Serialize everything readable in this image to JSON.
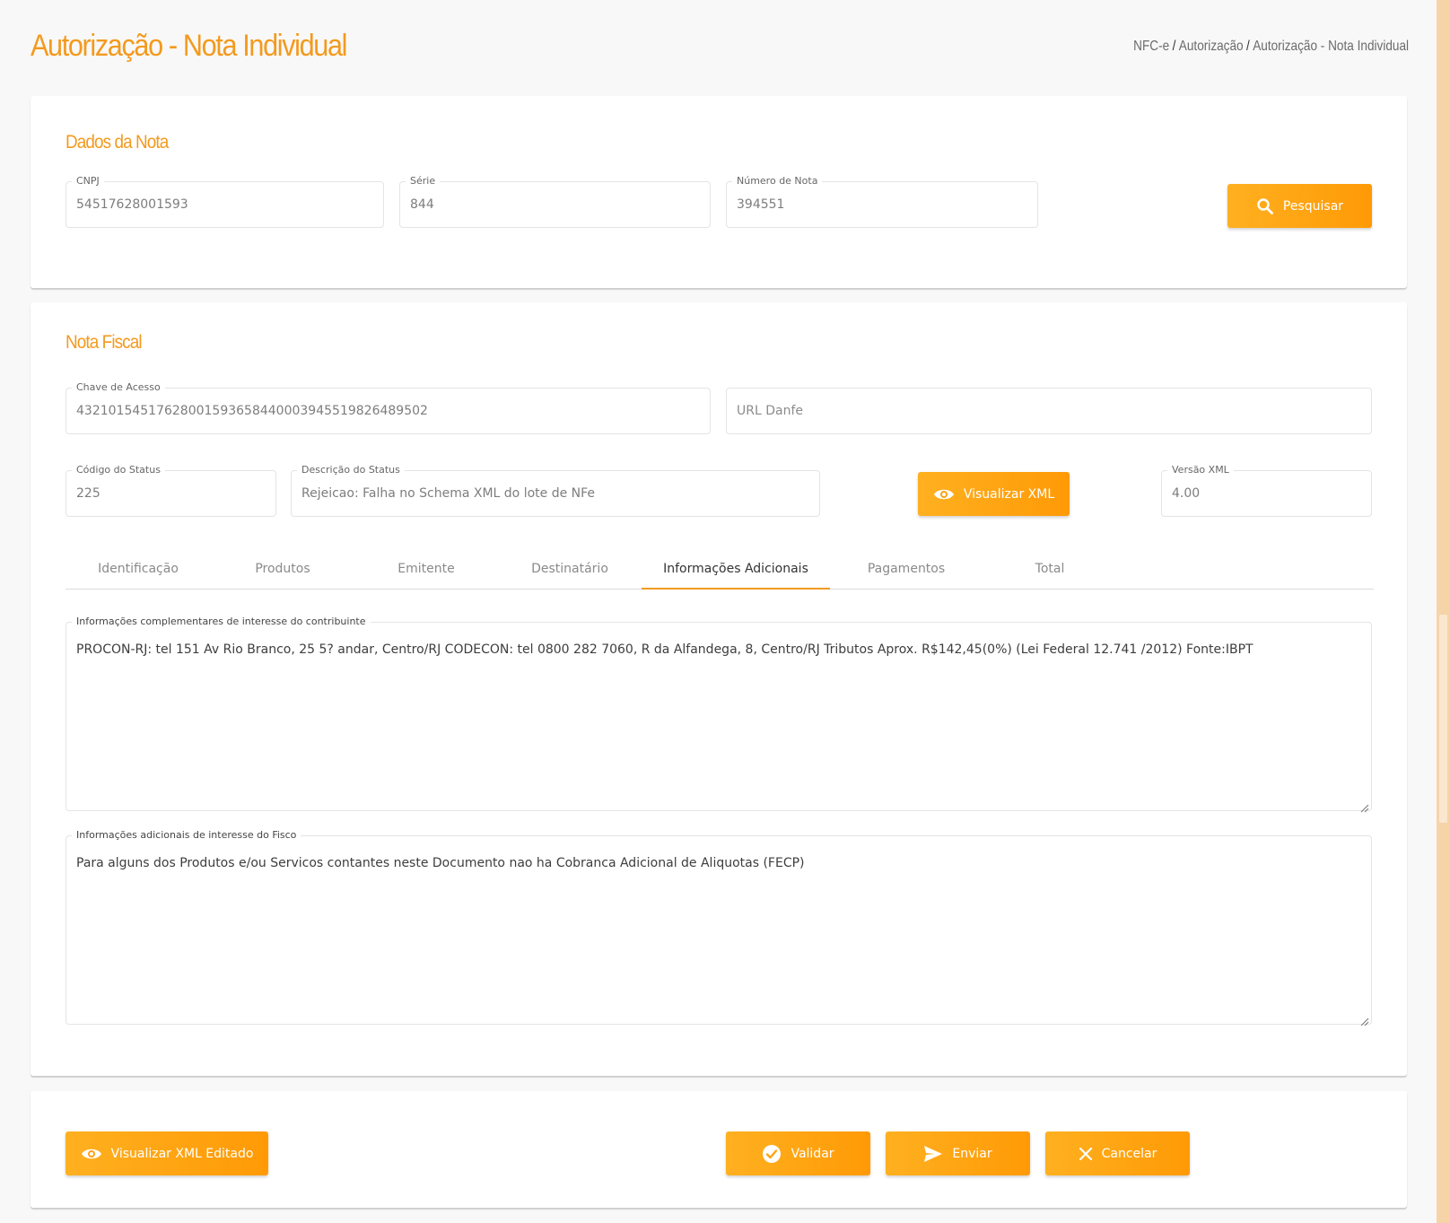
{
  "page": {
    "title": "Autorização - Nota Individual",
    "breadcrumb": [
      "NFC-e",
      "Autorização",
      "Autorização - Nota Individual"
    ]
  },
  "dados_nota": {
    "title": "Dados da Nota",
    "cnpj": {
      "label": "CNPJ",
      "value": "54517628001593"
    },
    "serie": {
      "label": "Série",
      "value": "844"
    },
    "numero": {
      "label": "Número de Nota",
      "value": "394551"
    },
    "search_button": "Pesquisar"
  },
  "nota_fiscal": {
    "title": "Nota Fiscal",
    "chave": {
      "label": "Chave de Acesso",
      "value": "43210154517628001593658440003945519826489502"
    },
    "url_danfe": {
      "placeholder": "URL Danfe"
    },
    "codigo_status": {
      "label": "Código do Status",
      "value": "225"
    },
    "descricao_status": {
      "label": "Descrição do Status",
      "value": "Rejeicao: Falha no Schema XML do lote de NFe"
    },
    "view_xml_button": "Visualizar XML",
    "versao_xml": {
      "label": "Versão XML",
      "value": "4.00"
    },
    "tabs": [
      {
        "label": "Identificação",
        "active": false
      },
      {
        "label": "Produtos",
        "active": false
      },
      {
        "label": "Emitente",
        "active": false
      },
      {
        "label": "Destinatário",
        "active": false
      },
      {
        "label": "Informações Adicionais",
        "active": true
      },
      {
        "label": "Pagamentos",
        "active": false
      },
      {
        "label": "Total",
        "active": false
      }
    ],
    "info_contribuinte": {
      "label": "Informações complementares de interesse do contribuinte",
      "value": "PROCON-RJ: tel 151 Av Rio Branco, 25 5? andar, Centro/RJ CODECON: tel 0800 282 7060, R da Alfandega, 8, Centro/RJ Tributos Aprox. R$142,45(0%)  (Lei Federal 12.741 /2012) Fonte:IBPT"
    },
    "info_fisco": {
      "label": "Informações adicionais de interesse do Fisco",
      "value": "Para alguns dos Produtos e/ou Servicos contantes neste Documento nao ha Cobranca Adicional de Aliquotas (FECP)"
    }
  },
  "footer_actions": {
    "view_edited_xml": "Visualizar XML Editado",
    "validate": "Validar",
    "send": "Enviar",
    "cancel": "Cancelar"
  },
  "colors": {
    "accent": "#f39a1e",
    "button": "#ffa310",
    "scrollbar": "#f6d4a8"
  },
  "icons": {
    "search": "search-icon",
    "eye": "eye-icon",
    "check": "check-circle-icon",
    "send": "send-icon",
    "close": "close-icon"
  }
}
